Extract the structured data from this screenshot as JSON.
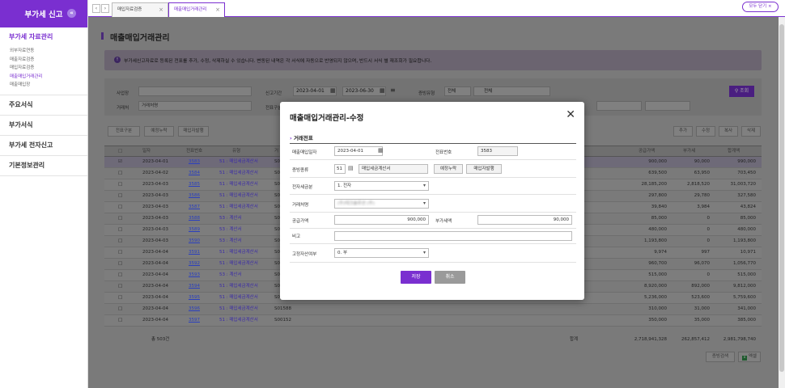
{
  "sidebar": {
    "title": "부가세 신고",
    "collapse_icon": "«",
    "sections": [
      {
        "label": "부가세 자료관리",
        "active": true,
        "subs": [
          "외부자료연동",
          "매출자료검증",
          "매입자료검증",
          "매출매입거래관리",
          "매출매입장"
        ]
      },
      {
        "label": "주요서식"
      },
      {
        "label": "부가서식"
      },
      {
        "label": "부가세 전자신고"
      },
      {
        "label": "기본정보관리"
      }
    ]
  },
  "tabs": {
    "prev": "‹",
    "next": "›",
    "items": [
      {
        "label": "매입자료검증"
      },
      {
        "label": "매출매입거래관리"
      }
    ],
    "close_icon": "×",
    "close_all": "모두 닫기 ×"
  },
  "page": {
    "title": "매출매입거래관리",
    "notice": "부가세신고자료로 등록된 전표를 추가, 수정, 삭제하실 수 있습니다. 변동된 내역은 각 서식에 자동으로 반영되지 않으며, 반드시 서식 별 재조회가 필요합니다.",
    "notice_icon": "!"
  },
  "filters": {
    "site_label": "사업장",
    "period_label": "신고기간",
    "date_from": "2023-04-01",
    "date_to": "2023-06-30",
    "evidence_label": "증빙유형",
    "evidence_value": "전체",
    "evidence_tag": "전체",
    "search_label": "조회",
    "vendor_label": "거래처",
    "vendor_value": "거래처명",
    "evidence_type_label": "전표구분"
  },
  "toolbar": {
    "type_select": "전표구분",
    "missing_btn": "예정누락",
    "issue_btn": "매입자발행",
    "add_btn": "추가",
    "edit_btn": "수정",
    "copy_btn": "복사",
    "delete_btn": "삭제"
  },
  "table": {
    "headers": {
      "date": "일자",
      "no": "전표번호",
      "type": "유형",
      "sel": "거",
      "supply": "공급가액",
      "vat": "부가세",
      "total": "합계액"
    },
    "rows": [
      {
        "date": "2023-04-01",
        "no": "3583",
        "type": "51 : 매입세금계산서",
        "code": "S0",
        "supply": "900,000",
        "vat": "90,000",
        "total": "990,000",
        "checked": true
      },
      {
        "date": "2023-04-02",
        "no": "3584",
        "type": "51 : 매입세금계산서",
        "code": "S0",
        "supply": "639,500",
        "vat": "63,950",
        "total": "703,450"
      },
      {
        "date": "2023-04-03",
        "no": "3585",
        "type": "51 : 매입세금계산서",
        "code": "S0",
        "supply": "28,185,200",
        "vat": "2,818,520",
        "total": "31,003,720"
      },
      {
        "date": "2023-04-03",
        "no": "3586",
        "type": "51 : 매입세금계산서",
        "code": "S0",
        "supply": "297,800",
        "vat": "29,780",
        "total": "327,580"
      },
      {
        "date": "2023-04-03",
        "no": "3587",
        "type": "51 : 매입세금계산서",
        "code": "S0",
        "supply": "39,840",
        "vat": "3,984",
        "total": "43,824"
      },
      {
        "date": "2023-04-03",
        "no": "3588",
        "type": "53 : 계산서",
        "code": "S0",
        "supply": "85,000",
        "vat": "0",
        "total": "85,000"
      },
      {
        "date": "2023-04-03",
        "no": "3589",
        "type": "53 : 계산서",
        "code": "S0",
        "supply": "480,000",
        "vat": "0",
        "total": "480,000"
      },
      {
        "date": "2023-04-03",
        "no": "3590",
        "type": "53 : 계산서",
        "code": "S0",
        "supply": "1,193,800",
        "vat": "0",
        "total": "1,193,800"
      },
      {
        "date": "2023-04-04",
        "no": "3591",
        "type": "51 : 매입세금계산서",
        "code": "S0",
        "supply": "9,974",
        "vat": "997",
        "total": "10,971"
      },
      {
        "date": "2023-04-04",
        "no": "3592",
        "type": "51 : 매입세금계산서",
        "code": "S0",
        "supply": "960,700",
        "vat": "96,070",
        "total": "1,056,770"
      },
      {
        "date": "2023-04-04",
        "no": "3593",
        "type": "53 : 계산서",
        "code": "S0",
        "supply": "515,000",
        "vat": "0",
        "total": "515,000"
      },
      {
        "date": "2023-04-04",
        "no": "3594",
        "type": "51 : 매입세금계산서",
        "code": "S0",
        "supply": "8,920,000",
        "vat": "892,000",
        "total": "9,812,000"
      },
      {
        "date": "2023-04-04",
        "no": "3595",
        "type": "51 : 매입세금계산서",
        "code": "S0",
        "supply": "5,236,000",
        "vat": "523,600",
        "total": "5,759,600"
      },
      {
        "date": "2023-04-04",
        "no": "3596",
        "type": "51 : 매입세금계산서",
        "code": "S01588",
        "supply": "310,000",
        "vat": "31,000",
        "total": "341,000"
      },
      {
        "date": "2023-04-04",
        "no": "3597",
        "type": "51 : 매입세금계산서",
        "code": "S00152",
        "supply": "350,000",
        "vat": "35,000",
        "total": "385,000"
      }
    ],
    "footer_count": "총 503건",
    "footer_label": "합계",
    "footer_supply": "2,718,941,328",
    "footer_vat": "262,857,412",
    "footer_total": "2,981,798,740"
  },
  "bottom": {
    "voucher_btn": "증빙검색",
    "excel_btn": "엑셀"
  },
  "modal": {
    "title": "매출매입거래관리-수정",
    "close_icon": "✕",
    "section": "거래전표",
    "labels": {
      "date": "매출매입일자",
      "voucher_no": "전표번호",
      "evidence": "증빙종류",
      "e_tax": "전자세금분",
      "vendor": "거래처명",
      "supply": "공급가액",
      "vat": "부가세액",
      "memo": "비고",
      "fixed_asset": "고정자산여부"
    },
    "values": {
      "date": "2023-04-01",
      "voucher_no": "3583",
      "evidence_code": "51",
      "evidence_name": "매입세금계산서",
      "e_tax": "1. 전자",
      "vendor": "(주)테크솔루션 (주)",
      "supply": "900,000",
      "vat": "90,000",
      "memo": "",
      "fixed_asset": "0. 부"
    },
    "buttons": {
      "missing": "예정누락",
      "issuer": "매입자발행",
      "save": "저장",
      "cancel": "취소"
    }
  },
  "colors": {
    "accent": "#7a2fd0",
    "overlay": "#7a7a7a"
  }
}
